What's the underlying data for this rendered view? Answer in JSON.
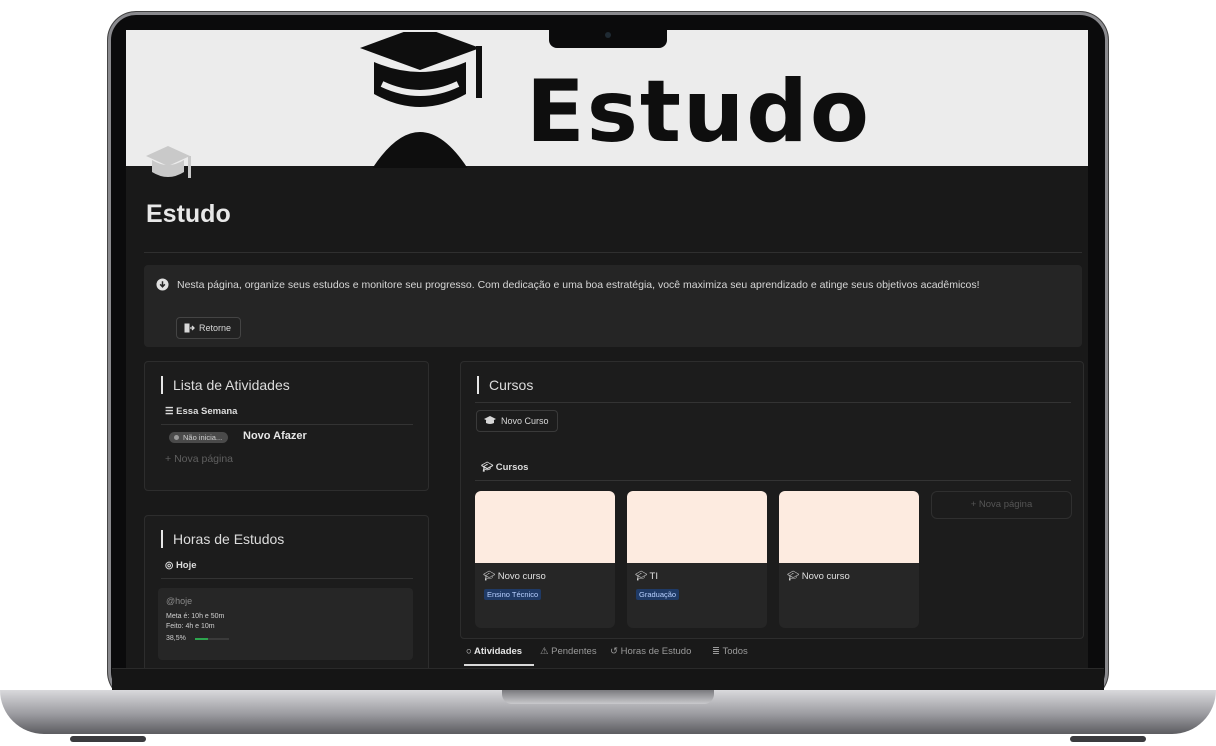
{
  "cover": {
    "title": "Estudo"
  },
  "page": {
    "title": "Estudo"
  },
  "callout": {
    "text": "Nesta página, organize seus estudos e monitore seu progresso. Com dedicação e uma boa estratégia, você maximiza seu aprendizado e atinge seus objetivos acadêmicos!",
    "button_label": "Retorne"
  },
  "activities": {
    "title": "Lista de Atividades",
    "view_label": "Essa Semana",
    "items": [
      {
        "status": "Não inicia...",
        "name": "Novo Afazer"
      }
    ],
    "new_page": "Nova página"
  },
  "hours": {
    "title": "Horas de Estudos",
    "view_label": "Hoje",
    "entry": {
      "name": "@hoje",
      "meta": "Meta é: 10h e 50m",
      "feito": "Feito: 4h e 10m",
      "percent": "38,5%",
      "progress": 0.385
    }
  },
  "courses": {
    "title": "Cursos",
    "button_label": "Novo Curso",
    "view_label": "Cursos",
    "cards": [
      {
        "title": "Novo curso",
        "tag": "Ensino Técnico"
      },
      {
        "title": "TI",
        "tag": "Graduação"
      },
      {
        "title": "Novo curso",
        "tag": ""
      }
    ],
    "new_page": "+ Nova página"
  },
  "tabs": [
    {
      "label": "Atividades",
      "icon": "circle-dashed-icon"
    },
    {
      "label": "Pendentes",
      "icon": "warning-icon"
    },
    {
      "label": "Horas de Estudo",
      "icon": "history-icon"
    },
    {
      "label": "Todos",
      "icon": "list-icon"
    }
  ],
  "colors": {
    "accent_green": "#2da44e",
    "tag_bg": "#1f3a66",
    "card_cover": "#fdebe0"
  }
}
